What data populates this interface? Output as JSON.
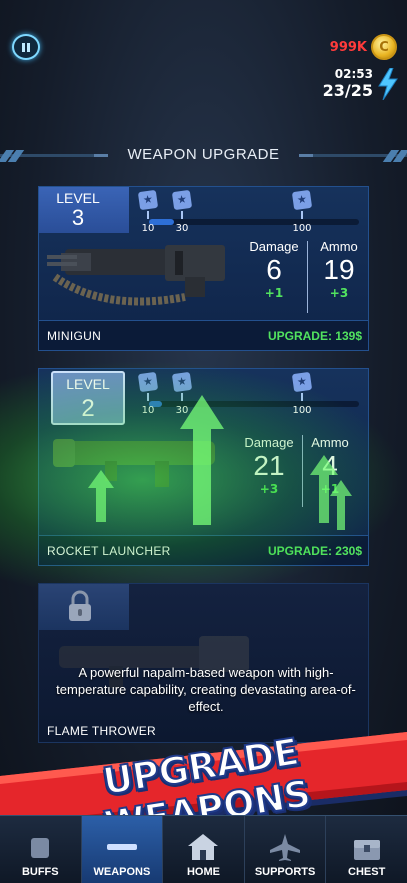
{
  "hud": {
    "currency_value": "999K",
    "coin_symbol": "C",
    "energy_timer": "02:53",
    "energy_count": "23/25"
  },
  "title": "WEAPON UPGRADE",
  "weapons": [
    {
      "level_label": "LEVEL",
      "level": "3",
      "milestones": [
        "10",
        "30",
        "100"
      ],
      "damage_label": "Damage",
      "damage": "6",
      "damage_inc": "+1",
      "ammo_label": "Ammo",
      "ammo": "19",
      "ammo_inc": "+3",
      "name": "MINIGUN",
      "upgrade": "UPGRADE: 139$",
      "progress": 0.12
    },
    {
      "level_label": "LEVEL",
      "level": "2",
      "milestones": [
        "10",
        "30",
        "100"
      ],
      "damage_label": "Damage",
      "damage": "21",
      "damage_inc": "+3",
      "ammo_label": "Ammo",
      "ammo": "4",
      "ammo_inc": "+1",
      "name": "ROCKET LAUNCHER",
      "upgrade": "UPGRADE: 230$",
      "progress": 0.06
    },
    {
      "locked": true,
      "description": "A powerful napalm-based weapon with high-temperature capability, creating devastating area-of-effect.",
      "name": "FLAME THROWER"
    }
  ],
  "banner": "UPGRADE WEAPONS",
  "nav": [
    {
      "label": "BUFFS",
      "icon": "buffs-icon",
      "active": false
    },
    {
      "label": "WEAPONS",
      "icon": "weapons-icon",
      "active": true
    },
    {
      "label": "HOME",
      "icon": "home-icon",
      "active": false
    },
    {
      "label": "SUPPORTS",
      "icon": "plane-icon",
      "active": false
    },
    {
      "label": "CHEST",
      "icon": "chest-icon",
      "active": false
    }
  ],
  "colors": {
    "accent_green": "#52e35f",
    "currency_red": "#ff3b3b",
    "card_blue": "#16325c",
    "banner_red": "#e5262b"
  }
}
